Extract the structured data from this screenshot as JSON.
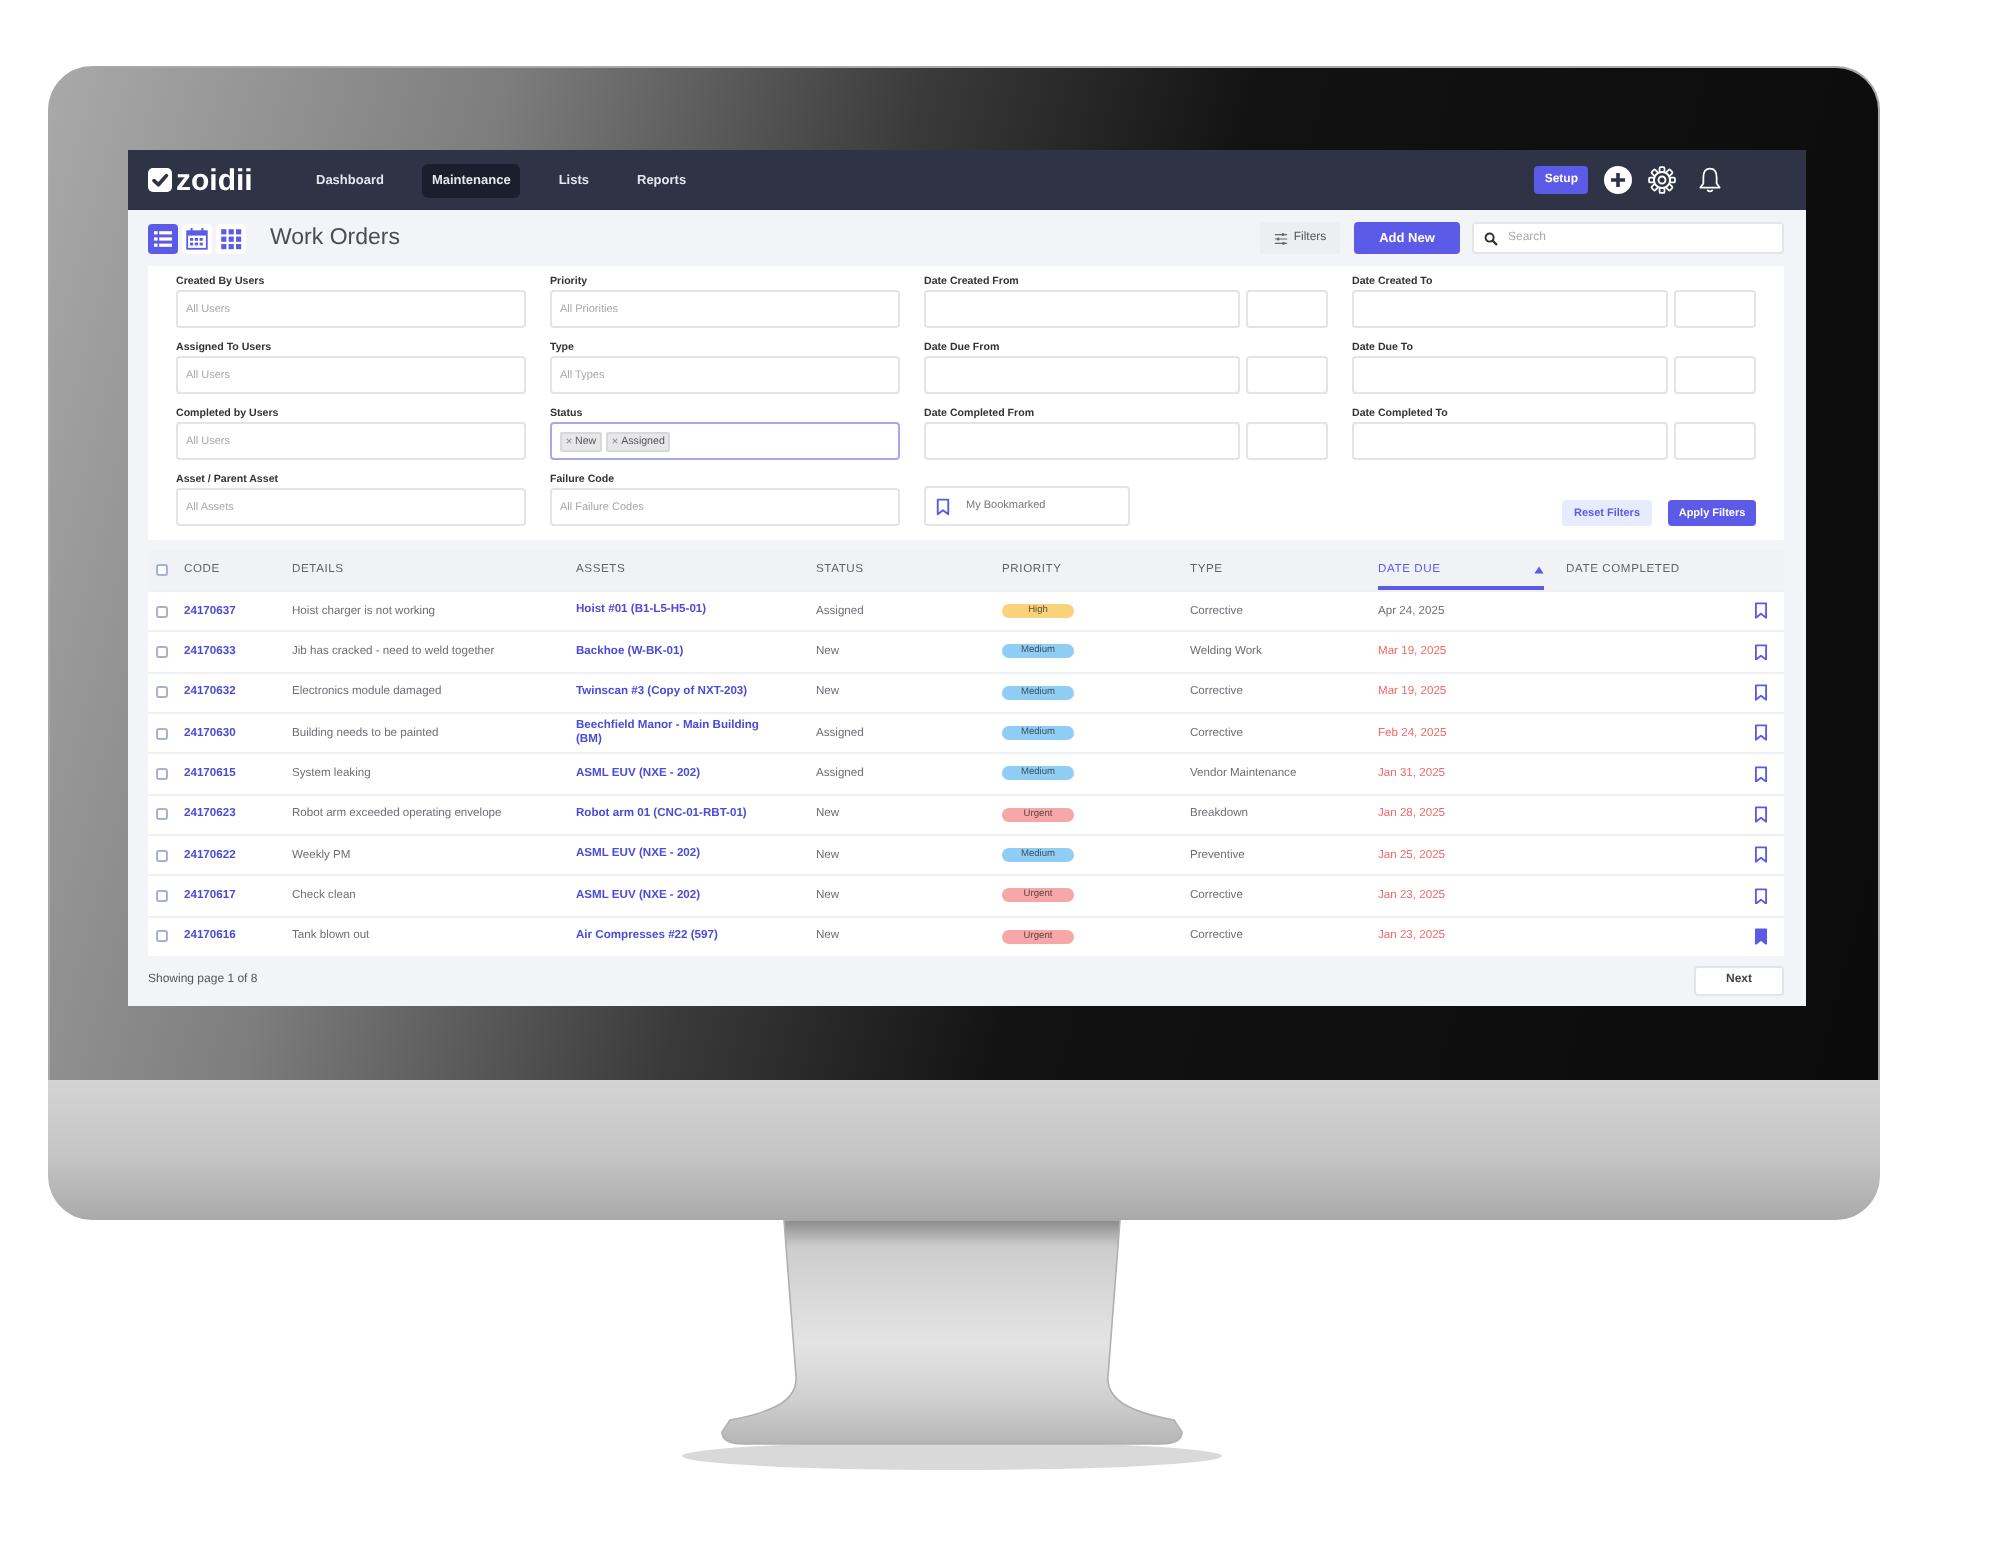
{
  "nav": {
    "logo": "zoidii",
    "items": [
      {
        "label": "Dashboard",
        "selected": false
      },
      {
        "label": "Maintenance",
        "selected": true
      },
      {
        "label": "Lists",
        "selected": false
      },
      {
        "label": "Reports",
        "selected": false
      }
    ],
    "setup_button": "Setup"
  },
  "toolbar": {
    "views": [
      {
        "kind": "list",
        "selected": true
      },
      {
        "kind": "calendar",
        "selected": false
      },
      {
        "kind": "grid",
        "selected": false
      }
    ],
    "title": "Work Orders",
    "filters_button": "Filters",
    "add_button": "Add New",
    "search": {
      "placeholder": "Search"
    }
  },
  "filters": {
    "fields": [
      {
        "kind": "select",
        "label": "Created By Users",
        "placeholder": "All Users",
        "focused": false
      },
      {
        "kind": "select",
        "label": "Priority",
        "placeholder": "All Priorities",
        "focused": false
      },
      {
        "kind": "date_range",
        "label": "Date Created From",
        "focused": false
      },
      {
        "kind": "date_range",
        "label": "Date Created To",
        "focused": false
      },
      {
        "kind": "select",
        "label": "Assigned To Users",
        "placeholder": "All Users",
        "focused": false
      },
      {
        "kind": "select",
        "label": "Type",
        "placeholder": "All Types",
        "focused": false
      },
      {
        "kind": "date_range",
        "label": "Date Due From",
        "focused": false
      },
      {
        "kind": "date_range",
        "label": "Date Due To",
        "focused": false
      },
      {
        "kind": "select",
        "label": "Completed by Users",
        "placeholder": "All Users",
        "focused": false
      },
      {
        "kind": "tags",
        "label": "Status",
        "tags": [
          "New",
          "Assigned"
        ],
        "focused": true
      },
      {
        "kind": "date_range",
        "label": "Date Completed From",
        "focused": false
      },
      {
        "kind": "date_range",
        "label": "Date Completed To",
        "focused": false
      },
      {
        "kind": "select",
        "label": "Asset / Parent Asset",
        "placeholder": "All Assets",
        "focused": false
      },
      {
        "kind": "select",
        "label": "Failure Code",
        "placeholder": "All Failure Codes",
        "focused": false
      },
      {
        "kind": "bookmark",
        "label": "My Bookmarked",
        "on": false
      }
    ],
    "buttons": [
      {
        "kind": "secondary",
        "label": "Reset Filters"
      },
      {
        "kind": "primary",
        "label": "Apply Filters"
      }
    ]
  },
  "table": {
    "select_all": {
      "checked": false
    },
    "columns": [
      {
        "label": "CODE",
        "sorted": false
      },
      {
        "label": "DETAILS",
        "sorted": false
      },
      {
        "label": "ASSETS",
        "sorted": false
      },
      {
        "label": "STATUS",
        "sorted": false
      },
      {
        "label": "PRIORITY",
        "sorted": false
      },
      {
        "label": "TYPE",
        "sorted": false
      },
      {
        "label": "DATE DUE",
        "sorted": true
      },
      {
        "label": "DATE COMPLETED",
        "sorted": false
      }
    ],
    "rows": [
      {
        "checked": false,
        "code": "24170637",
        "details": "Hoist charger is not working",
        "asset": "Hoist #01 (B1-L5-H5-01)",
        "status": "Assigned",
        "priority": {
          "label": "High",
          "color": "#f9d27c"
        },
        "type": "Corrective",
        "date_due": "Apr 24, 2025",
        "overdue": false,
        "bookmarked": false
      },
      {
        "checked": false,
        "code": "24170633",
        "details": "Jib has cracked - need to weld together",
        "asset": "Backhoe (W-BK-01)",
        "status": "New",
        "priority": {
          "label": "Medium",
          "color": "#8fcdf5"
        },
        "type": "Welding Work",
        "date_due": "Mar 19, 2025",
        "overdue": true,
        "bookmarked": false
      },
      {
        "checked": false,
        "code": "24170632",
        "details": "Electronics module damaged",
        "asset": "Twinscan #3 (Copy of NXT-203)",
        "status": "New",
        "priority": {
          "label": "Medium",
          "color": "#8fcdf5"
        },
        "type": "Corrective",
        "date_due": "Mar 19, 2025",
        "overdue": true,
        "bookmarked": false
      },
      {
        "checked": false,
        "code": "24170630",
        "details": "Building needs to be painted",
        "asset": "Beechfield Manor - Main Building (BM)",
        "status": "Assigned",
        "priority": {
          "label": "Medium",
          "color": "#8fcdf5"
        },
        "type": "Corrective",
        "date_due": "Feb 24, 2025",
        "overdue": true,
        "bookmarked": false
      },
      {
        "checked": false,
        "code": "24170615",
        "details": "System leaking",
        "asset": "ASML EUV (NXE - 202)",
        "status": "Assigned",
        "priority": {
          "label": "Medium",
          "color": "#8fcdf5"
        },
        "type": "Vendor Maintenance",
        "date_due": "Jan 31, 2025",
        "overdue": true,
        "bookmarked": false
      },
      {
        "checked": false,
        "code": "24170623",
        "details": "Robot arm exceeded operating envelope",
        "asset": "Robot arm 01 (CNC-01-RBT-01)",
        "status": "New",
        "priority": {
          "label": "Urgent",
          "color": "#f7a7a7"
        },
        "type": "Breakdown",
        "date_due": "Jan 28, 2025",
        "overdue": true,
        "bookmarked": false
      },
      {
        "checked": false,
        "code": "24170622",
        "details": "Weekly PM",
        "asset": "ASML EUV (NXE - 202)",
        "status": "New",
        "priority": {
          "label": "Medium",
          "color": "#8fcdf5"
        },
        "type": "Preventive",
        "date_due": "Jan 25, 2025",
        "overdue": true,
        "bookmarked": false
      },
      {
        "checked": false,
        "code": "24170617",
        "details": "Check clean",
        "asset": "ASML EUV (NXE - 202)",
        "status": "New",
        "priority": {
          "label": "Urgent",
          "color": "#f7a7a7"
        },
        "type": "Corrective",
        "date_due": "Jan 23, 2025",
        "overdue": true,
        "bookmarked": false
      },
      {
        "checked": false,
        "code": "24170616",
        "details": "Tank blown out",
        "asset": "Air Compresses #22 (597)",
        "status": "New",
        "priority": {
          "label": "Urgent",
          "color": "#f7a7a7"
        },
        "type": "Corrective",
        "date_due": "Jan 23, 2025",
        "overdue": true,
        "bookmarked": true
      }
    ]
  },
  "footer": {
    "page_info": "Showing page 1 of 8",
    "next_button": "Next"
  }
}
